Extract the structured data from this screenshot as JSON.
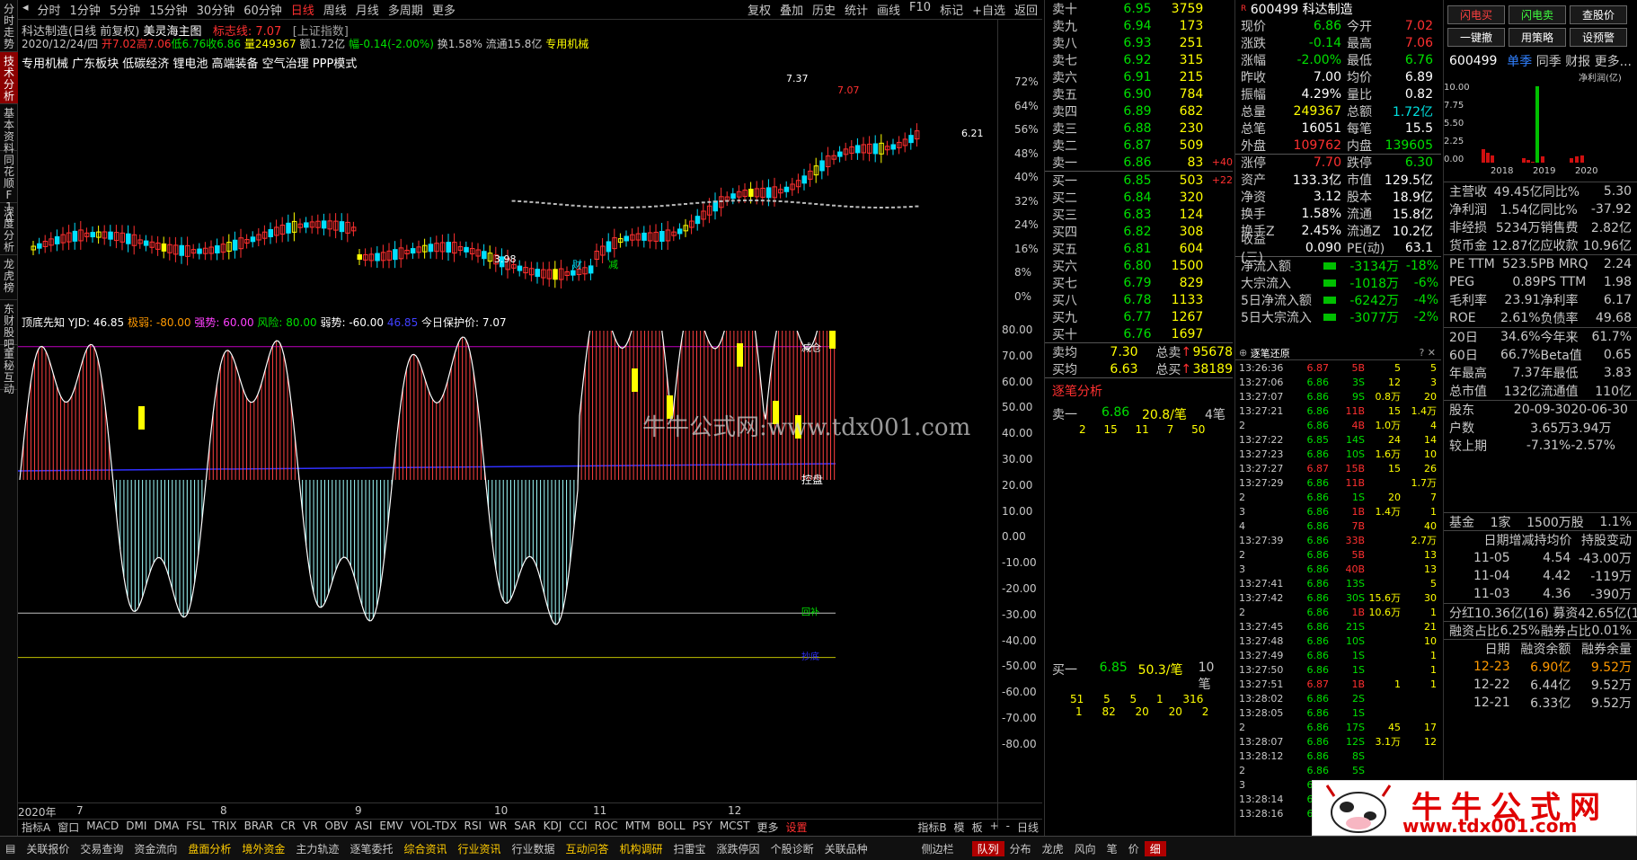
{
  "left_tabs": [
    "分时走势",
    "技术分析",
    "基本资料",
    "同花顺F10",
    "深度分析",
    "龙虎榜",
    "东财股吧",
    "董秘互动"
  ],
  "period_tabs": [
    "分时",
    "1分钟",
    "5分钟",
    "15分钟",
    "30分钟",
    "60分钟",
    "日线",
    "周线",
    "月线",
    "多周期",
    "更多"
  ],
  "top_right": [
    "复权",
    "叠加",
    "历史",
    "统计",
    "画线",
    "F10",
    "标记",
    "+自选",
    "返回"
  ],
  "stock": {
    "name": "科达制造",
    "adj": "(日线 前复权)",
    "indicator": "美灵海主图",
    "jz": "标志线: 7.07",
    "index": "[上证指数]",
    "date": "2020/12/24/四",
    "open": "开7.02",
    "high": "高7.06",
    "low": "低6.76",
    "close": "收6.86",
    "vol": "量249367",
    "amt": "额1.72亿",
    "chg": "幅-0.14(-2.00%)",
    "turn": "换1.58%",
    "flow": "流通15.8亿",
    "sector": "专用机械",
    "tags": "专用机械  广东板块  低碳经济  锂电池  高端装备  空气治理  PPP模式"
  },
  "kchart": {
    "annot_high": "7.37",
    "annot_low": "3.98",
    "annot_last": "7.07",
    "label_cai": "财",
    "label_jian": "减",
    "price_tag": "6.21"
  },
  "axis_top": [
    "72%",
    "64%",
    "56%",
    "48%",
    "40%",
    "32%",
    "24%",
    "16%",
    "8%",
    "0%"
  ],
  "axis_ind": [
    "80.00",
    "70.00",
    "60.00",
    "50.00",
    "40.00",
    "30.00",
    "20.00",
    "10.00",
    "0.00",
    "-10.00",
    "-20.00",
    "-30.00",
    "-40.00",
    "-50.00",
    "-60.00",
    "-70.00",
    "-80.00"
  ],
  "ind": {
    "name": "顶底先知",
    "yjd": "YJD: 46.85",
    "jr": "极弱: -80.00",
    "qs": "强势: 60.00",
    "fx": "风险: 80.00",
    "rs": "弱势: -60.00",
    "v46": "46.85",
    "bh": "今日保护价: 7.07",
    "lbl_top": "清仓",
    "lbl_jc": "减仓",
    "lbl_kp": "控盘",
    "lbl_sw": "回补",
    "lbl_bot": "抄底"
  },
  "dates": [
    "2020年",
    "7",
    "8",
    "9",
    "10",
    "11",
    "12"
  ],
  "ind_tabs": [
    "指标A",
    "窗口",
    "MACD",
    "DMI",
    "DMA",
    "FSL",
    "TRIX",
    "BRAR",
    "CR",
    "VR",
    "OBV",
    "ASI",
    "EMV",
    "VOL-TDX",
    "RSI",
    "WR",
    "SAR",
    "KDJ",
    "CCI",
    "ROC",
    "MTM",
    "BOLL",
    "PSY",
    "MCST",
    "更多",
    "设置"
  ],
  "ind_tabs_right": [
    "指标B",
    "模",
    "板",
    "+",
    "-",
    "日线"
  ],
  "bottom": [
    "关联报价",
    "交易查询",
    "资金流向",
    "盘面分析",
    "境外资金",
    "主力轨迹",
    "逐笔委托",
    "综合资讯",
    "行业资讯",
    "行业数据",
    "互动问答",
    "机构调研",
    "扫雷宝",
    "涨跌停因",
    "个股诊断",
    "关联品种",
    "侧边栏",
    "队列",
    "分布",
    "龙虎",
    "风向",
    "笔",
    "价",
    "细"
  ],
  "asks": [
    [
      "卖十",
      "6.95",
      "3759",
      ""
    ],
    [
      "卖九",
      "6.94",
      "173",
      ""
    ],
    [
      "卖八",
      "6.93",
      "251",
      ""
    ],
    [
      "卖七",
      "6.92",
      "315",
      ""
    ],
    [
      "卖六",
      "6.91",
      "215",
      ""
    ],
    [
      "卖五",
      "6.90",
      "784",
      ""
    ],
    [
      "卖四",
      "6.89",
      "682",
      ""
    ],
    [
      "卖三",
      "6.88",
      "230",
      ""
    ],
    [
      "卖二",
      "6.87",
      "509",
      ""
    ],
    [
      "卖一",
      "6.86",
      "83",
      "+40"
    ]
  ],
  "bids": [
    [
      "买一",
      "6.85",
      "503",
      "+22"
    ],
    [
      "买二",
      "6.84",
      "320",
      ""
    ],
    [
      "买三",
      "6.83",
      "124",
      ""
    ],
    [
      "买四",
      "6.82",
      "308",
      ""
    ],
    [
      "买五",
      "6.81",
      "604",
      ""
    ],
    [
      "买六",
      "6.80",
      "1500",
      ""
    ],
    [
      "买七",
      "6.79",
      "829",
      ""
    ],
    [
      "买八",
      "6.78",
      "1133",
      ""
    ],
    [
      "买九",
      "6.77",
      "1267",
      ""
    ],
    [
      "买十",
      "6.76",
      "1697",
      ""
    ]
  ],
  "ob_sum": {
    "avg_s": "卖均",
    "avg_s_v": "7.30",
    "tot_s": "总卖",
    "tot_s_v": "95678",
    "avg_b": "买均",
    "avg_b_v": "6.63",
    "tot_b": "总买",
    "tot_b_v": "38189",
    "title": "逐笔分析",
    "s1": "卖一",
    "s1p": "6.86",
    "s1q": "20.8/笔",
    "s1n": "4笔",
    "s1row": "2 15 11 7 50",
    "b1": "买一",
    "b1p": "6.85",
    "b1q": "50.3/笔",
    "b1n": "10笔",
    "b1r1": "51 5 5 1 316",
    "b1r2": "1 82 20 20 2"
  },
  "quote_title": "600499 科达制造",
  "quote": [
    [
      "现价",
      "6.86",
      "今开",
      "7.02"
    ],
    [
      "涨跌",
      "-0.14",
      "最高",
      "7.06"
    ],
    [
      "涨幅",
      "-2.00%",
      "最低",
      "6.76"
    ],
    [
      "昨收",
      "7.00",
      "均价",
      "6.89"
    ],
    [
      "振幅",
      "4.29%",
      "量比",
      "0.82"
    ],
    [
      "总量",
      "249367",
      "总额",
      "1.72亿"
    ],
    [
      "总笔",
      "16051",
      "每笔",
      "15.5"
    ],
    [
      "外盘",
      "109762",
      "内盘",
      "139605"
    ],
    [
      "涨停",
      "7.70",
      "跌停",
      "6.30"
    ],
    [
      "资产",
      "133.3亿",
      "市值",
      "129.5亿"
    ],
    [
      "净资",
      "3.12",
      "股本",
      "18.9亿"
    ],
    [
      "换手",
      "1.58%",
      "流通",
      "15.8亿"
    ],
    [
      "换手Z",
      "2.45%",
      "流通Z",
      "10.2亿"
    ],
    [
      "收益(三)",
      "0.090",
      "PE(动)",
      "63.1"
    ]
  ],
  "flows": [
    [
      "净流入额",
      "-3134万",
      "-18%"
    ],
    [
      "大宗流入",
      "-1018万",
      "-6%"
    ],
    [
      "5日净流入额",
      "-6242万",
      "-4%"
    ],
    [
      "5日大宗流入",
      "-3077万",
      "-2%"
    ]
  ],
  "ticks_title": "逐笔还原",
  "ticks": [
    [
      "13:26:36",
      "6.87",
      "5B",
      "5",
      "5"
    ],
    [
      "13:27:06",
      "6.86",
      "3S",
      "12",
      "3"
    ],
    [
      "13:27:07",
      "6.86",
      "9S",
      "0.8万",
      "20"
    ],
    [
      "13:27:21",
      "6.86",
      "11B",
      "15",
      "1.4万"
    ],
    [
      "2",
      "6.86",
      "4B",
      "1.0万",
      "4"
    ],
    [
      "13:27:22",
      "6.85",
      "14S",
      "24",
      "14"
    ],
    [
      "13:27:23",
      "6.86",
      "10S",
      "1.6万",
      "10"
    ],
    [
      "13:27:27",
      "6.87",
      "15B",
      "15",
      "26"
    ],
    [
      "13:27:29",
      "6.86",
      "11B",
      "",
      "1.7万"
    ],
    [
      "2",
      "6.86",
      "1S",
      "20",
      "7"
    ],
    [
      "3",
      "6.86",
      "1B",
      "1.4万",
      "1"
    ],
    [
      "4",
      "6.86",
      "7B",
      "",
      "40"
    ],
    [
      "13:27:39",
      "6.86",
      "33B",
      "",
      "2.7万"
    ],
    [
      "2",
      "6.86",
      "5B",
      "",
      "13"
    ],
    [
      "3",
      "6.86",
      "40B",
      "",
      "13"
    ],
    [
      "13:27:41",
      "6.86",
      "13S",
      "",
      "5"
    ],
    [
      "13:27:42",
      "6.86",
      "30S",
      "15.6万",
      "30"
    ],
    [
      "2",
      "6.86",
      "1B",
      "10.6万",
      "1"
    ],
    [
      "13:27:45",
      "6.86",
      "21S",
      "",
      "21"
    ],
    [
      "13:27:48",
      "6.86",
      "10S",
      "",
      "10"
    ],
    [
      "13:27:49",
      "6.86",
      "1S",
      "",
      "1"
    ],
    [
      "13:27:50",
      "6.86",
      "1S",
      "",
      "1"
    ],
    [
      "13:27:51",
      "6.87",
      "1B",
      "1",
      "1"
    ],
    [
      "13:28:02",
      "6.86",
      "2S",
      "",
      ""
    ],
    [
      "13:28:05",
      "6.86",
      "1S",
      "",
      ""
    ],
    [
      "2",
      "6.86",
      "17S",
      "45",
      "17"
    ],
    [
      "13:28:07",
      "6.86",
      "12S",
      "3.1万",
      "12"
    ],
    [
      "13:28:12",
      "6.86",
      "8S",
      "",
      ""
    ],
    [
      "2",
      "6.86",
      "5S",
      "",
      ""
    ],
    [
      "3",
      "6.86",
      "",
      "",
      ""
    ],
    [
      "13:28:14",
      "6.86",
      "",
      "",
      ""
    ],
    [
      "13:28:16",
      "6.86",
      "",
      "",
      ""
    ]
  ],
  "f10": {
    "btns": [
      "闪电买",
      "闪电卖",
      "查股价",
      "一键撤",
      "用策略",
      "设预警"
    ],
    "code": "600499",
    "tabs": [
      "单季",
      "同季",
      "财报",
      "更多..."
    ],
    "chart_title": "净利润(亿)",
    "chart_y": [
      "10.00",
      "7.75",
      "5.50",
      "2.25",
      "0.00"
    ],
    "chart_x": [
      "2018",
      "2019",
      "2020"
    ],
    "rows1": [
      [
        "主营收",
        "49.45亿",
        "同比%",
        "5.30"
      ],
      [
        "净利润",
        "1.54亿",
        "同比%",
        "-37.92"
      ],
      [
        "非经损",
        "5234万",
        "销售费",
        "2.82亿"
      ],
      [
        "货币金",
        "12.87亿",
        "应收款",
        "10.96亿"
      ]
    ],
    "rows2": [
      [
        "PE TTM",
        "523.5",
        "PB MRQ",
        "2.24"
      ],
      [
        "PEG",
        "0.89",
        "PS TTM",
        "1.98"
      ],
      [
        "毛利率",
        "23.91",
        "净利率",
        "6.17"
      ],
      [
        "ROE",
        "2.61%",
        "负债率",
        "49.68"
      ]
    ],
    "rows3": [
      [
        "20日",
        "34.6%",
        "今年来",
        "61.7%"
      ],
      [
        "60日",
        "66.7%",
        "Beta值",
        "0.65"
      ],
      [
        "年最高",
        "7.37",
        "年最低",
        "3.83"
      ],
      [
        "总市值",
        "132亿",
        "流通值",
        "110亿"
      ]
    ],
    "rows4": [
      [
        "股东",
        "20-09-30",
        "20-06-30"
      ],
      [
        "户数",
        "3.65万",
        "3.94万"
      ],
      [
        "较上期",
        "-7.31%",
        "-2.57%"
      ]
    ],
    "fund": [
      "基金",
      "1家",
      "1500万股",
      "1.1%"
    ],
    "hold_hdr": [
      "日期",
      "增减持均价",
      "持股变动"
    ],
    "hold": [
      [
        "11-05",
        "4.54",
        "-43.00万"
      ],
      [
        "11-04",
        "4.42",
        "-119万"
      ],
      [
        "11-03",
        "4.36",
        "-390万"
      ]
    ],
    "div": "分红10.36亿(16) 募资42.65亿(16)",
    "mr": [
      "融资占比",
      "6.25%",
      "融券占比",
      "0.01%"
    ],
    "mhdr": [
      "日期",
      "融资余额",
      "融券余量"
    ],
    "mrows": [
      [
        "12-23",
        "6.90亿",
        "9.52万"
      ],
      [
        "12-22",
        "6.44亿",
        "9.52万"
      ],
      [
        "12-21",
        "6.33亿",
        "9.52万"
      ]
    ]
  },
  "watermark1": "牛牛公式网:www.tdx001.com",
  "watermark2": {
    "t1": "牛牛公式网",
    "t2": "www.tdx001.com"
  }
}
